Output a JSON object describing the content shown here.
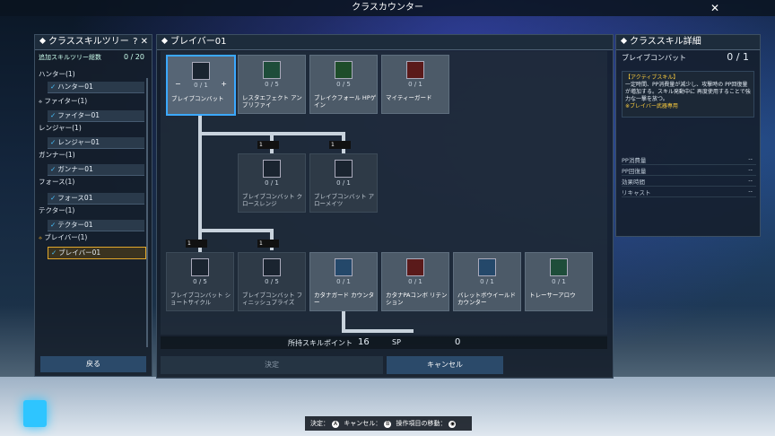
{
  "window": {
    "title": "クラスカウンター"
  },
  "left_panel": {
    "title": "クラススキルツリー",
    "add_label": "追加スキルツリー総数",
    "add_value": "0 / 20",
    "back_label": "戻る",
    "classes": [
      {
        "label": "ハンター(1)",
        "sub": "ハンター01"
      },
      {
        "label": "ファイター(1)",
        "sub": "ファイター01"
      },
      {
        "label": "レンジャー(1)",
        "sub": "レンジャー01"
      },
      {
        "label": "ガンナー(1)",
        "sub": "ガンナー01"
      },
      {
        "label": "フォース(1)",
        "sub": "フォース01"
      },
      {
        "label": "テクター(1)",
        "sub": "テクター01"
      },
      {
        "label": "ブレイバー(1)",
        "sub": "ブレイバー01"
      }
    ]
  },
  "center_panel": {
    "title": "ブレイバー01",
    "nodes": [
      {
        "name": "ブレイブコンバット",
        "level": "0 / 1"
      },
      {
        "name": "レスタエフェクト アンプリファイ",
        "level": "0 / 5"
      },
      {
        "name": "ブレイクフォール HPゲイン",
        "level": "0 / 5"
      },
      {
        "name": "マイティーガード",
        "level": "0 / 1"
      },
      {
        "name": "ブレイブコンバット クロースレンジ",
        "level": "0 / 1"
      },
      {
        "name": "ブレイブコンバット アローメイツ",
        "level": "0 / 1"
      },
      {
        "name": "ブレイブコンバット ショートサイクル",
        "level": "0 / 5"
      },
      {
        "name": "ブレイブコンバット フィニッシュプライズ",
        "level": "0 / 5"
      },
      {
        "name": "カタナガード カウンター",
        "level": "0 / 1"
      },
      {
        "name": "カタナPAコンボ リテンション",
        "level": "0 / 1"
      },
      {
        "name": "バレットボウイールド カウンター",
        "level": "0 / 1"
      },
      {
        "name": "トレーサーアロウ",
        "level": "0 / 1"
      }
    ],
    "lock_label": "1",
    "sp_label": "所持スキルポイント",
    "sp_value": "16",
    "sp_unit": "SP",
    "sp_used": "0",
    "confirm_label": "決定",
    "cancel_label": "キャンセル"
  },
  "right_panel": {
    "title": "クラススキル詳細",
    "skill_name": "ブレイブコンバット",
    "skill_level": "0 / 1",
    "desc_tag": "【アクティブスキル】",
    "desc_body": "一定時間、PP消費量が減少し、攻撃時の PP回復量が増加する。スキル発動中に 再度使用することで強力な一撃を放つ。",
    "desc_note": "※ブレイバー武器専用",
    "stats": [
      {
        "label": "PP消費量",
        "value": "--"
      },
      {
        "label": "PP回復量",
        "value": "--"
      },
      {
        "label": "効果時間",
        "value": "--"
      },
      {
        "label": "リキャスト",
        "value": "--"
      }
    ]
  },
  "help_bar": {
    "confirm": "決定：",
    "cancel": "キャンセル：",
    "move": "操作項目の移動："
  },
  "colors": {
    "accent": "#3ba8ff",
    "selected": "#e2a82b",
    "desc_highlight": "#ffcf3d"
  }
}
